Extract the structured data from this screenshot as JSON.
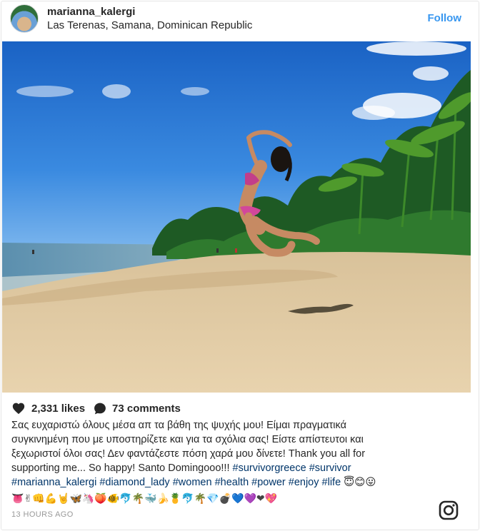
{
  "post": {
    "username": "marianna_kalergi",
    "location": "Las Terenas, Samana, Dominican Republic",
    "follow_label": "Follow",
    "likes": "2,331 likes",
    "comments": "73 comments",
    "time": "13 HOURS AGO"
  },
  "caption": {
    "line1": "Σας ευχαριστώ όλους μέσα απ τα βάθη της ψυχής μου! Είμαι πραγματικά",
    "line2": "συγκινημένη που με υποστηρίζετε και για τα σχόλια σας! Είστε απίστευτοι και",
    "line3": "ξεχωριστοί όλοι σας! Δεν φαντάζεστε πόση χαρά μου δίνετε! Thank you all for",
    "line4_text": "supporting me... So happy! Santo Domingooo!!! ",
    "tags_line4": [
      "#survivorgreece",
      "#survivor"
    ],
    "tags_line5": [
      "#marianna_kalergi",
      "#diamond_lady",
      "#women",
      "#health",
      "#power",
      "#enjoy",
      "#life"
    ],
    "emoji_line5": "😇😊😛",
    "emoji_row": "👅✌👊💪🤘🦋🦄🍑🐠🐬🌴🐳🍌🍍🐬🌴💎💣💙💜❤💖"
  },
  "icons": {
    "heart": "heart-icon",
    "comment": "comment-icon",
    "logo": "instagram-icon"
  },
  "colors": {
    "follow": "#3897f0",
    "hashtag": "#003569",
    "muted": "#999999"
  }
}
